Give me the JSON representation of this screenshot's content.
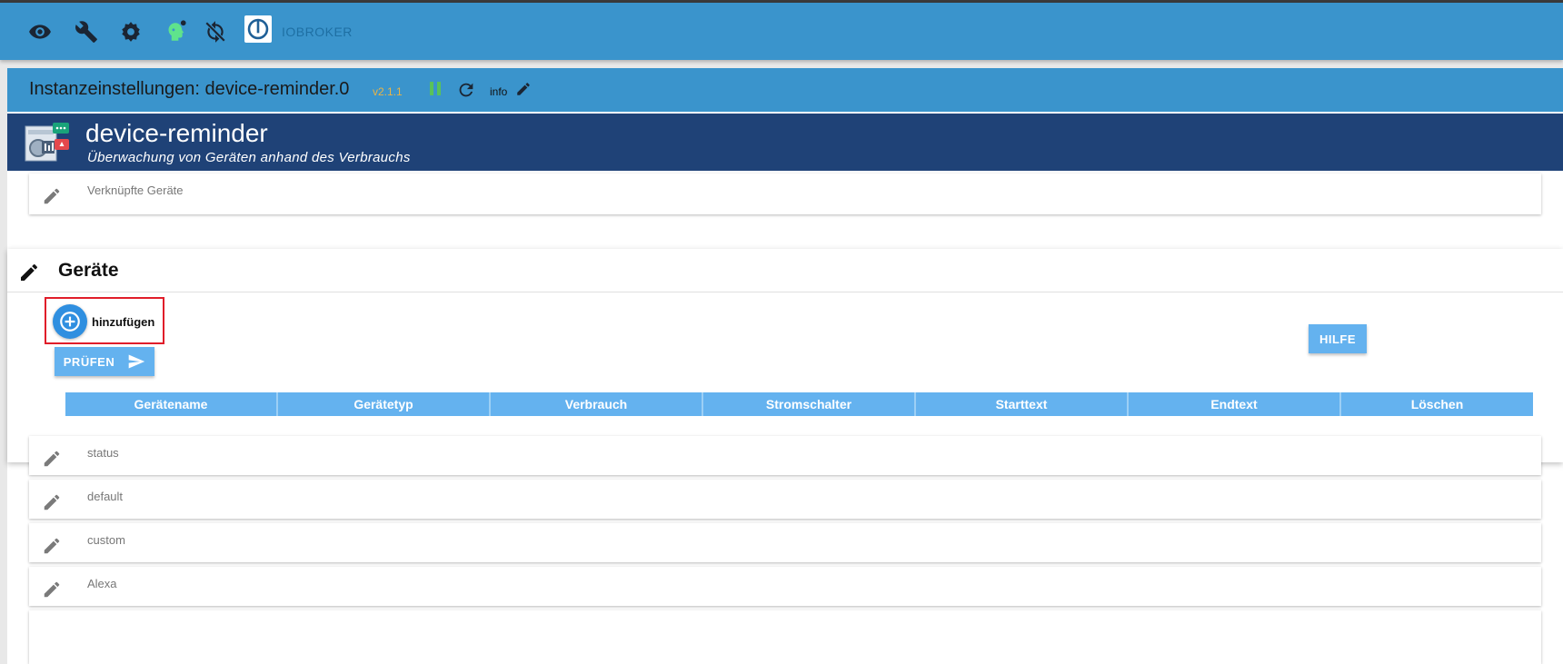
{
  "topbar": {
    "brand": "IOBROKER",
    "icons": [
      "eye-icon",
      "wrench-icon",
      "settings-icon",
      "head-icon",
      "sync-off-icon",
      "iobroker-logo"
    ]
  },
  "instance": {
    "title": "Instanzeinstellungen: device-reminder.0",
    "version": "v2.1.1",
    "info_label": "info"
  },
  "banner": {
    "title": "device-reminder",
    "subtitle": "Überwachung von Geräten anhand des Verbrauchs"
  },
  "panels": {
    "linked": "Verknüpfte Geräte",
    "status": "status",
    "default": "default",
    "custom": "custom",
    "alexa": "Alexa"
  },
  "devices_section": {
    "title": "Geräte",
    "add_label": "hinzufügen",
    "check_button": "PRÜFEN",
    "help_button": "HILFE",
    "columns": [
      "Gerätename",
      "Gerätetyp",
      "Verbrauch",
      "Stromschalter",
      "Starttext",
      "Endtext",
      "Löschen"
    ]
  },
  "colors": {
    "accent": "#3a94cc",
    "banner": "#1f4277",
    "button": "#64b2ef",
    "highlight": "#e01d2a"
  }
}
